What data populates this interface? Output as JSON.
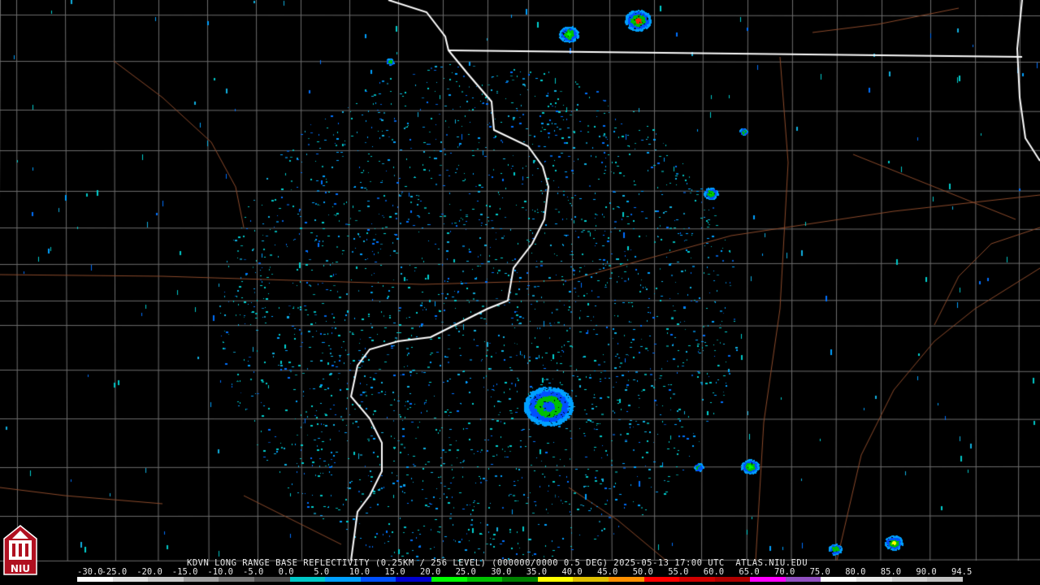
{
  "radar": {
    "caption": "KDVN LONG RANGE BASE REFLECTIVITY (0.25KM / 256 LEVEL) (000000/0000 0.5 DEG) 2025-05-13 17:00 UTC  ATLAS.NIU.EDU",
    "station": "KDVN",
    "product": "LONG RANGE BASE REFLECTIVITY",
    "timestamp": "2025-05-13 17:00 UTC",
    "source": "ATLAS.NIU.EDU"
  },
  "scale": {
    "labels": [
      "-30.0",
      "-25.0",
      "-20.0",
      "-15.0",
      "-10.0",
      "-5.0",
      "0.0",
      "5.0",
      "10.0",
      "15.0",
      "20.0",
      "25.0",
      "30.0",
      "35.0",
      "40.0",
      "45.0",
      "50.0",
      "55.0",
      "60.0",
      "65.0",
      "70.0",
      "75.0",
      "80.0",
      "85.0",
      "90.0",
      "94.5"
    ],
    "colors": [
      "#ffffff",
      "#e0e0e0",
      "#c8c8c8",
      "#a0a0a0",
      "#787878",
      "#505050",
      "#00c8c8",
      "#00a0ff",
      "#0050ff",
      "#0000d0",
      "#00ff00",
      "#00c000",
      "#008000",
      "#ffff00",
      "#e0c000",
      "#ff9000",
      "#ff0000",
      "#d00000",
      "#b00000",
      "#ff00ff",
      "#9050c0",
      "#ffffff",
      "#e8e8e8",
      "#d0d0d0",
      "#c0c0c0"
    ]
  },
  "logo": {
    "text": "NIU",
    "icon": "niu-logo-icon"
  },
  "colors": {
    "background": "#000000",
    "county_lines": "#6e6e6e",
    "roads": "#8b4a2b",
    "state_lines": "#ffffff"
  }
}
